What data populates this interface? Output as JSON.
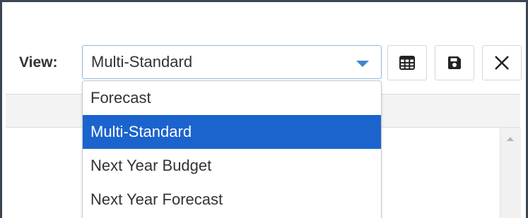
{
  "toolbar": {
    "view_label": "View:",
    "view_select": {
      "value": "Multi-Standard",
      "options": [
        "Forecast",
        "Multi-Standard",
        "Next Year Budget",
        "Next Year Forecast"
      ],
      "selected_index": 1
    },
    "buttons": [
      {
        "name": "grid-view",
        "icon": "table-grid-icon"
      },
      {
        "name": "save",
        "icon": "floppy-disk-icon"
      },
      {
        "name": "close",
        "icon": "close-x-icon"
      }
    ]
  },
  "colors": {
    "frame_border": "#3c4650",
    "selected_bg": "#1b64cd",
    "caret": "#3d86cf",
    "text": "#333333"
  }
}
